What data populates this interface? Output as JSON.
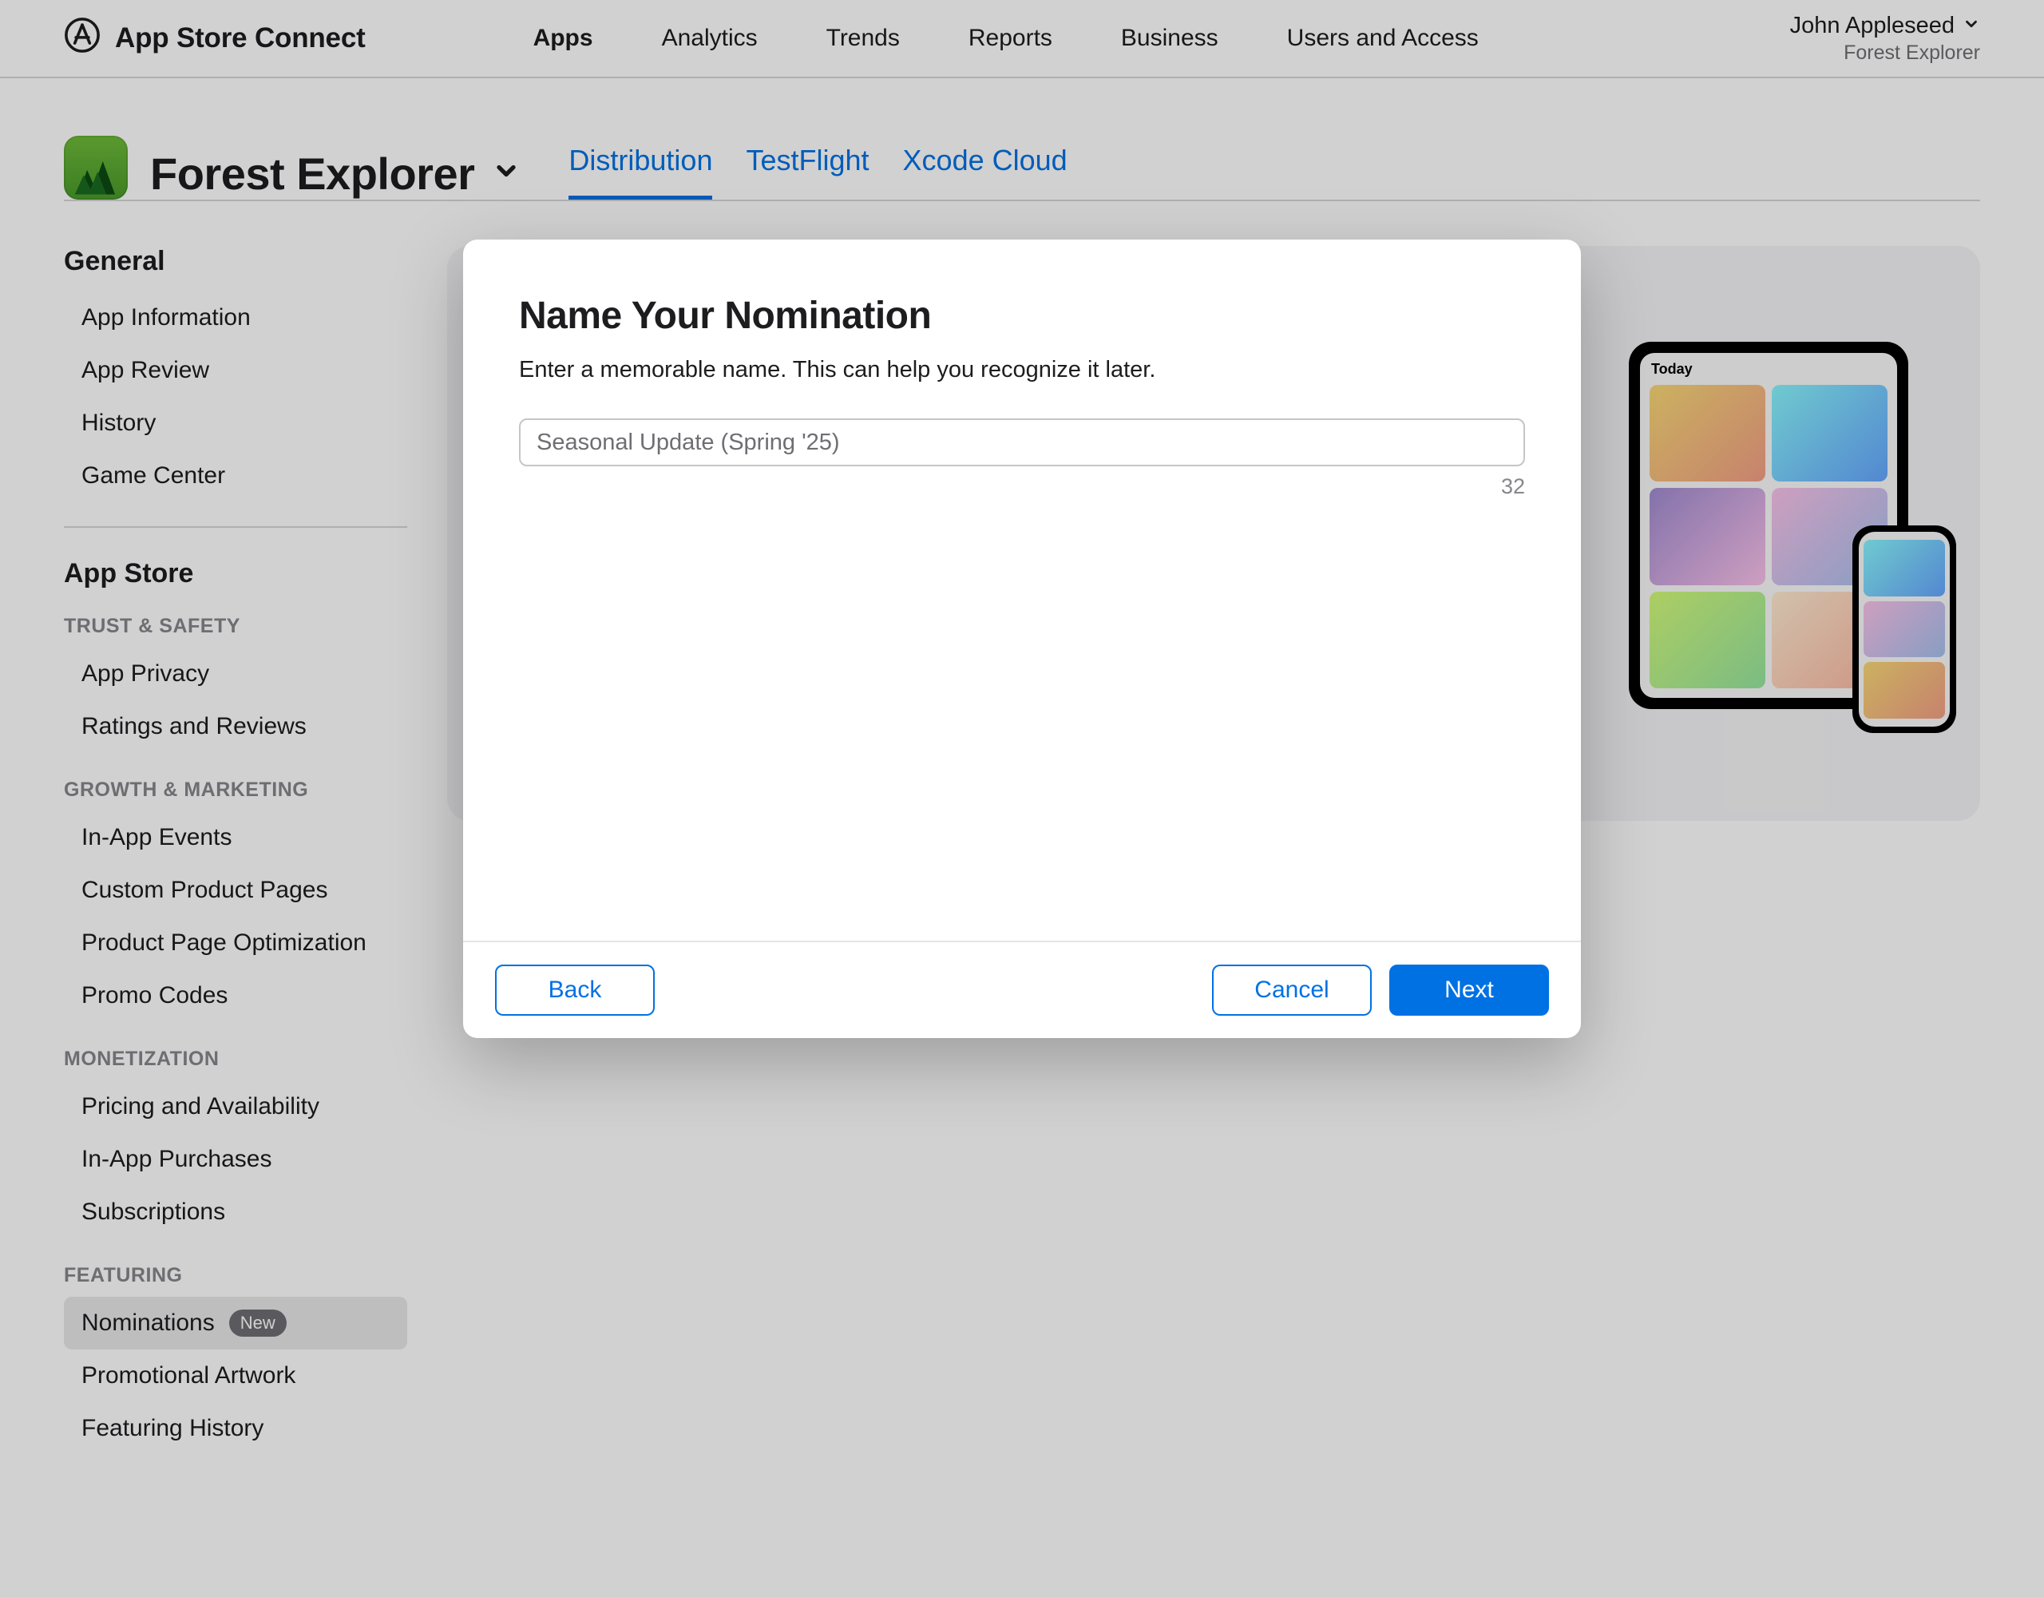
{
  "brand": "App Store Connect",
  "topnav": {
    "apps": "Apps",
    "analytics": "Analytics",
    "trends": "Trends",
    "reports": "Reports",
    "business": "Business",
    "users": "Users and Access"
  },
  "account": {
    "user": "John Appleseed",
    "org": "Forest Explorer"
  },
  "app": {
    "name": "Forest Explorer"
  },
  "tabs": {
    "distribution": "Distribution",
    "testflight": "TestFlight",
    "xcodecloud": "Xcode Cloud"
  },
  "sidebar": {
    "general_heading": "General",
    "general": {
      "app_information": "App Information",
      "app_review": "App Review",
      "history": "History",
      "game_center": "Game Center"
    },
    "app_store_heading": "App Store",
    "trust_safety_heading": "TRUST & SAFETY",
    "trust_safety": {
      "app_privacy": "App Privacy",
      "ratings_reviews": "Ratings and Reviews"
    },
    "growth_heading": "GROWTH & MARKETING",
    "growth": {
      "in_app_events": "In-App Events",
      "custom_product_pages": "Custom Product Pages",
      "product_page_optimization": "Product Page Optimization",
      "promo_codes": "Promo Codes"
    },
    "monetization_heading": "MONETIZATION",
    "monetization": {
      "pricing": "Pricing and Availability",
      "iap": "In-App Purchases",
      "subscriptions": "Subscriptions"
    },
    "featuring_heading": "FEATURING",
    "featuring": {
      "nominations": "Nominations",
      "nominations_badge": "New",
      "promotional_artwork": "Promotional Artwork",
      "featuring_history": "Featuring History"
    }
  },
  "modal": {
    "title": "Name Your Nomination",
    "description": "Enter a memorable name. This can help you recognize it later.",
    "input_value": "Seasonal Update (Spring '25)",
    "char_count": "32",
    "back": "Back",
    "cancel": "Cancel",
    "next": "Next"
  }
}
